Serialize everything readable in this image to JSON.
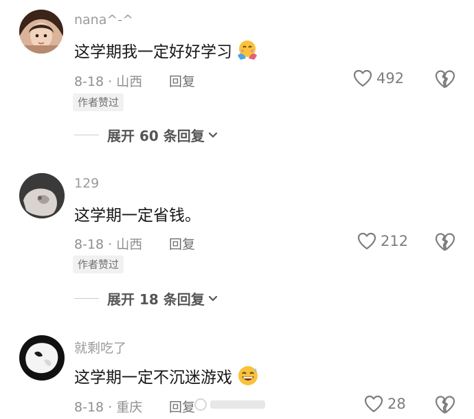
{
  "comments": [
    {
      "username": "nana^-^",
      "text": "这学期我一定好好学习",
      "emoji": "hug-face-emoji",
      "date_location": "8-18 · 山西",
      "reply_label": "回复",
      "likes": "492",
      "badge": "作者赞过",
      "expand_text": "展开 60 条回复"
    },
    {
      "username": "129",
      "text": "这学期一定省钱。",
      "date_location": "8-18 · 山西",
      "reply_label": "回复",
      "likes": "212",
      "badge": "作者赞过",
      "expand_text": "展开 18 条回复"
    },
    {
      "username": "就剩吃了",
      "text": "这学期一定不沉迷游戏",
      "emoji": "grin-sweat-emoji",
      "date_location": "8-18 · 重庆",
      "reply_label": "回复",
      "likes": "28"
    }
  ],
  "colors": {
    "text_primary": "#161616",
    "text_secondary": "#9a9a9a",
    "badge_bg": "#f1f1f1",
    "emoji_yellow": "#f8c33a"
  },
  "icons": [
    "heart-outline-icon",
    "broken-heart-icon",
    "chevron-down-icon"
  ]
}
